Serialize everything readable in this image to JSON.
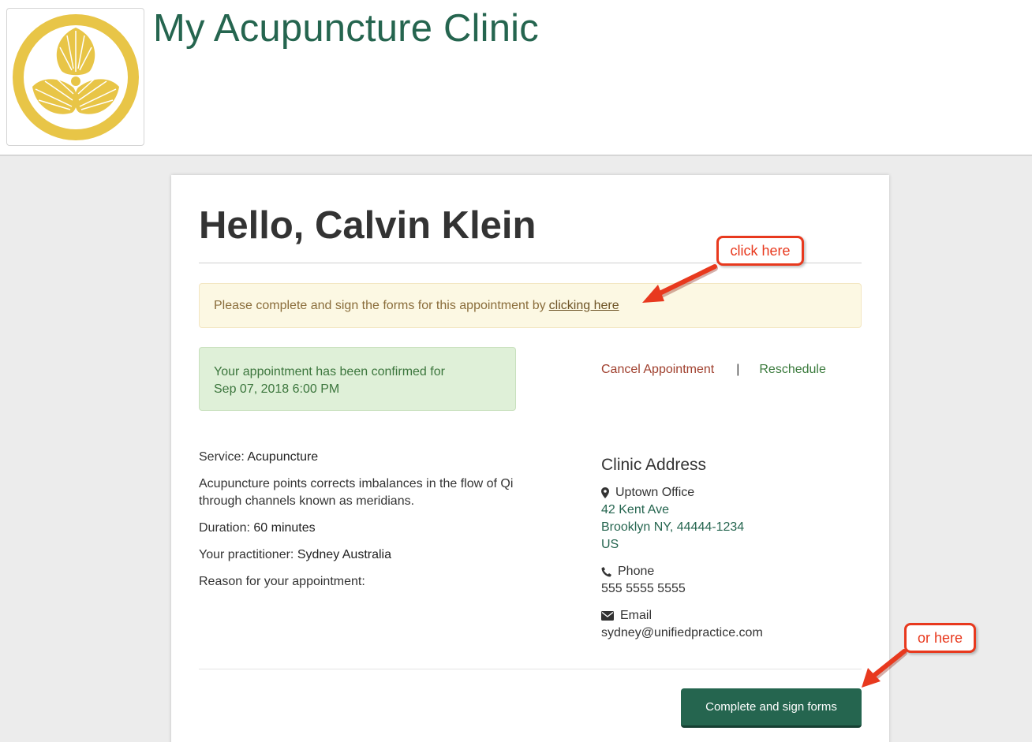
{
  "header": {
    "clinic_name": "My Acupuncture Clinic",
    "logo_icon": "gold-crest-logo"
  },
  "greeting": "Hello, Calvin Klein",
  "forms_alert": {
    "text": "Please complete and sign the forms for this appointment by",
    "link": "clicking here"
  },
  "confirmation": {
    "line1": "Your appointment has been confirmed for",
    "line2": "Sep 07, 2018 6:00 PM"
  },
  "actions": {
    "cancel": "Cancel Appointment",
    "separator": "|",
    "reschedule": "Reschedule"
  },
  "details": {
    "service_label": "Service:",
    "service_value": "Acupuncture",
    "description": "Acupuncture points corrects imbalances in the flow of Qi through channels known as meridians.",
    "duration_label": "Duration:",
    "duration_value": "60 minutes",
    "practitioner_label": "Your practitioner:",
    "practitioner_value": "Sydney Australia",
    "reason_label": "Reason for your appointment:"
  },
  "clinic_address": {
    "heading": "Clinic Address",
    "office": "Uptown Office",
    "street": "42 Kent Ave",
    "city": "Brooklyn NY, 44444-1234",
    "country": "US",
    "phone_label": "Phone",
    "phone": "555 5555 5555",
    "email_label": "Email",
    "email": "sydney@unifiedpractice.com"
  },
  "button": {
    "complete_forms": "Complete and sign forms"
  },
  "annotations": {
    "callout1": "click here",
    "callout2": "or here"
  },
  "colors": {
    "brand_green": "#25654f",
    "callout_red": "#e8391e",
    "logo_gold": "#e8c547"
  }
}
